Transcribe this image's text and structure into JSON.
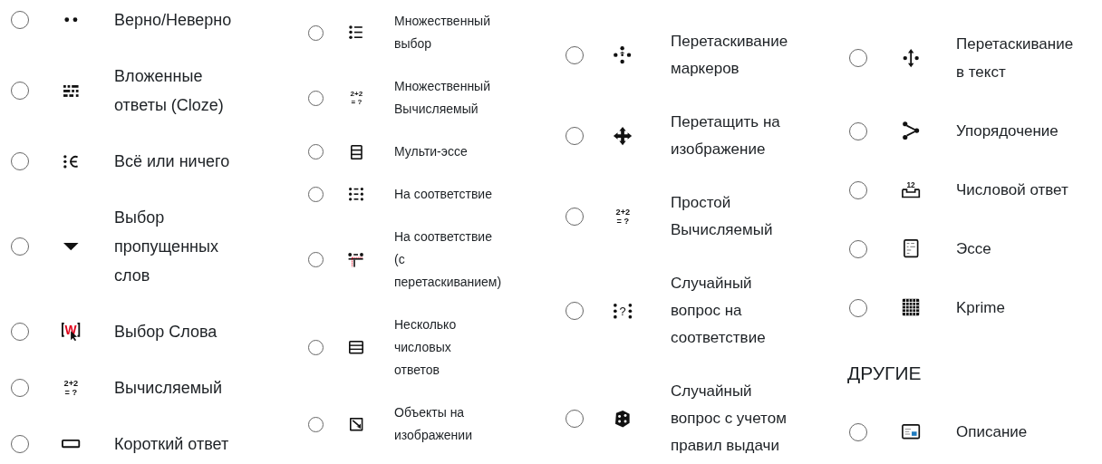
{
  "columns": [
    {
      "items": [
        {
          "kind": "truefalse",
          "label": "Верно/Неверно",
          "selected": false
        },
        {
          "kind": "cloze",
          "label": "Вложенные\nответы (Cloze)",
          "selected": false
        },
        {
          "kind": "allornothing",
          "label": "Всё или ничего",
          "selected": false
        },
        {
          "kind": "dropdown",
          "label": "Выбор\nпропущенных\nслов",
          "selected": false
        },
        {
          "kind": "wordselect",
          "icon_text": [
            "W"
          ],
          "label": "Выбор Слова",
          "selected": false
        },
        {
          "kind": "calculated",
          "icon_text": [
            "2+2",
            "= ?"
          ],
          "label": "Вычисляемый",
          "selected": false
        },
        {
          "kind": "shortanswer",
          "label": "Короткий ответ",
          "selected": false
        }
      ]
    },
    {
      "items": [
        {
          "kind": "multichoice",
          "label": "Множественный\nвыбор",
          "selected": false
        },
        {
          "kind": "calculated",
          "icon_text": [
            "2+2",
            "= ?"
          ],
          "label": "Множественный\nВычисляемый",
          "selected": false
        },
        {
          "kind": "multiessay",
          "label": "Мульти-эссе",
          "selected": false
        },
        {
          "kind": "match",
          "label": "На соответствие",
          "selected": false
        },
        {
          "kind": "ddmatch",
          "label": "На соответствие\n(с\nперетаскиванием)",
          "selected": false
        },
        {
          "kind": "multinumerical",
          "label": "Несколько\nчисловых\nответов",
          "selected": false
        },
        {
          "kind": "imageobjects",
          "label": "Объекты на\nизображении",
          "selected": false
        }
      ]
    },
    {
      "items": [
        {
          "kind": "ddmarker",
          "label": "Перетаскивание\nмаркеров",
          "selected": false
        },
        {
          "kind": "ddimage",
          "label": "Перетащить на\nизображение",
          "selected": false
        },
        {
          "kind": "calculated",
          "icon_text": [
            "2+2",
            "= ?"
          ],
          "label": "Простой\nВычисляемый",
          "selected": false
        },
        {
          "kind": "randommatch",
          "icon_text": [
            "?"
          ],
          "label": "Случайный\nвопрос на\nсоответствие",
          "selected": false
        },
        {
          "kind": "randomrules",
          "label": "Случайный\nвопрос с учетом\nправил выдачи",
          "selected": false
        }
      ]
    },
    {
      "items": [
        {
          "kind": "ddwtos",
          "label": "Перетаскивание\nв текст",
          "selected": false
        },
        {
          "kind": "ordering",
          "label": "Упорядочение",
          "selected": false
        },
        {
          "kind": "numerical",
          "icon_text": [
            "12"
          ],
          "label": "Числовой ответ",
          "selected": false
        },
        {
          "kind": "essay",
          "label": "Эссе",
          "selected": false
        },
        {
          "kind": "kprime",
          "label": "Kprime",
          "selected": false
        },
        {
          "kind": "heading",
          "label": "ДРУГИЕ"
        },
        {
          "kind": "description",
          "label": "Описание",
          "selected": false
        }
      ]
    }
  ]
}
